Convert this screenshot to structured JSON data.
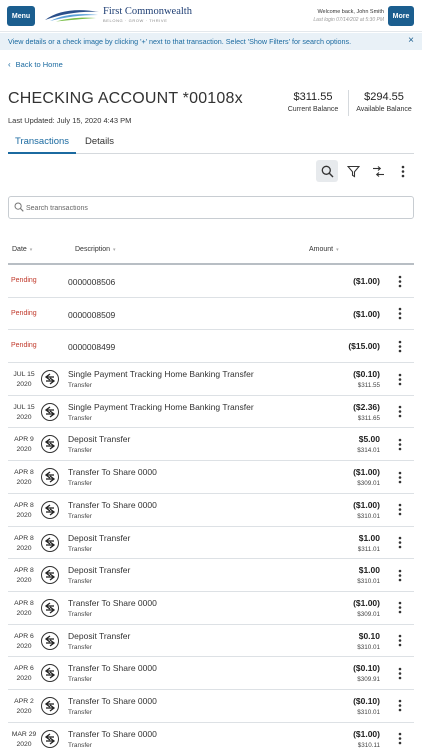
{
  "header": {
    "menu_label": "Menu",
    "more_label": "More",
    "brand_name": "First Commonwealth",
    "brand_tagline": "BELONG · GROW · THRIVE",
    "welcome": "Welcome back, John Smith",
    "last_login": "Last login 07/14/202 at 5:30 PM"
  },
  "banner": {
    "text": "View details or a check image by clicking '+' next to that transaction. Select 'Show Filters' for search options.",
    "close": "×"
  },
  "back_link": "Back to Home",
  "account": {
    "title": "CHECKING ACCOUNT *00108x",
    "last_updated": "Last Updated: July 15, 2020 4:43 PM",
    "current_balance": "$311.55",
    "current_balance_label": "Current Balance",
    "available_balance": "$294.55",
    "available_balance_label": "Available Balance"
  },
  "tabs": [
    {
      "label": "Transactions",
      "active": true
    },
    {
      "label": "Details",
      "active": false
    }
  ],
  "toolbar": {
    "icons": [
      "search-icon",
      "filter-icon",
      "sort-icon",
      "more-vertical-icon"
    ]
  },
  "search": {
    "placeholder": "Search transactions"
  },
  "columns": {
    "date": "Date",
    "description": "Description",
    "amount": "Amount"
  },
  "pending_transactions": [
    {
      "status": "Pending",
      "description": "0000008506",
      "amount": "($1.00)"
    },
    {
      "status": "Pending",
      "description": "0000008509",
      "amount": "($1.00)"
    },
    {
      "status": "Pending",
      "description": "0000008499",
      "amount": "($15.00)"
    }
  ],
  "transactions": [
    {
      "month_day": "JUL 15",
      "year": "2020",
      "description": "Single Payment Tracking Home Banking Transfer",
      "category": "Transfer",
      "amount": "($0.10)",
      "balance": "$311.55"
    },
    {
      "month_day": "JUL 15",
      "year": "2020",
      "description": "Single Payment Tracking Home Banking Transfer",
      "category": "Transfer",
      "amount": "($2.36)",
      "balance": "$311.65"
    },
    {
      "month_day": "APR 9",
      "year": "2020",
      "description": "Deposit Transfer",
      "category": "Transfer",
      "amount": "$5.00",
      "balance": "$314.01"
    },
    {
      "month_day": "APR 8",
      "year": "2020",
      "description": "Transfer To Share 0000",
      "category": "Transfer",
      "amount": "($1.00)",
      "balance": "$309.01"
    },
    {
      "month_day": "APR 8",
      "year": "2020",
      "description": "Transfer To Share 0000",
      "category": "Transfer",
      "amount": "($1.00)",
      "balance": "$310.01"
    },
    {
      "month_day": "APR 8",
      "year": "2020",
      "description": "Deposit Transfer",
      "category": "Transfer",
      "amount": "$1.00",
      "balance": "$311.01"
    },
    {
      "month_day": "APR 8",
      "year": "2020",
      "description": "Deposit Transfer",
      "category": "Transfer",
      "amount": "$1.00",
      "balance": "$310.01"
    },
    {
      "month_day": "APR 8",
      "year": "2020",
      "description": "Transfer To Share 0000",
      "category": "Transfer",
      "amount": "($1.00)",
      "balance": "$309.01"
    },
    {
      "month_day": "APR 6",
      "year": "2020",
      "description": "Deposit Transfer",
      "category": "Transfer",
      "amount": "$0.10",
      "balance": "$310.01"
    },
    {
      "month_day": "APR 6",
      "year": "2020",
      "description": "Transfer To Share 0000",
      "category": "Transfer",
      "amount": "($0.10)",
      "balance": "$309.91"
    },
    {
      "month_day": "APR 2",
      "year": "2020",
      "description": "Transfer To Share 0000",
      "category": "Transfer",
      "amount": "($0.10)",
      "balance": "$310.01"
    },
    {
      "month_day": "MAR 29",
      "year": "2020",
      "description": "Transfer To Share 0000",
      "category": "Transfer",
      "amount": "($1.00)",
      "balance": "$310.11"
    }
  ]
}
